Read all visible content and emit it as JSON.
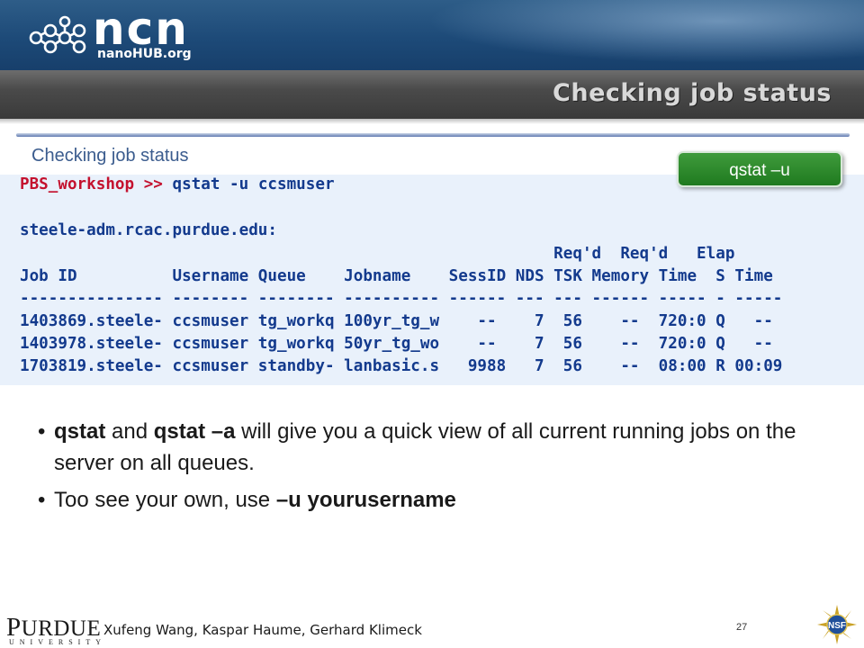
{
  "header": {
    "logo_text": "ncn",
    "logo_subtext": "nanoHUB.org",
    "slide_title": "Checking job status"
  },
  "content": {
    "sub_heading": "Checking job status",
    "badge_label": "qstat –u"
  },
  "terminal": {
    "prompt": "PBS_workshop",
    "prompt_symbol": ">>",
    "command": " qstat -u ccsmuser",
    "host_line": "steele-adm.rcac.purdue.edu:",
    "header_line_1": "                                                        Req'd  Req'd   Elap",
    "header_line_2": "Job ID          Username Queue    Jobname    SessID NDS TSK Memory Time  S Time",
    "separator": "--------------- -------- -------- ---------- ------ --- --- ------ ----- - -----",
    "rows": [
      "1403869.steele- ccsmuser tg_workq 100yr_tg_w    --    7  56    --  720:0 Q   --",
      "1403978.steele- ccsmuser tg_workq 50yr_tg_wo    --    7  56    --  720:0 Q   --",
      "1703819.steele- ccsmuser standby- lanbasic.s   9988   7  56    --  08:00 R 00:09"
    ]
  },
  "bullets": [
    {
      "part1_bold": "qstat",
      "part2": " and ",
      "part3_bold": "qstat –a",
      "part4": " will give you a quick view of all current running jobs on the server on all queues."
    },
    {
      "part1": "Too see your own, use ",
      "part2_bold": "–u yourusername"
    }
  ],
  "footer": {
    "university_initial": "P",
    "university_rest": "URDUE",
    "university_sub": "UNIVERSITY",
    "authors": "Xufeng Wang, Kaspar Haume, Gerhard Klimeck",
    "page_number": "27",
    "nsf_logo_text": "NSF"
  },
  "colors": {
    "banner_blue": "#1d4a78",
    "title_bar": "#4a4a4a",
    "terminal_bg": "#e9f1fb",
    "terminal_text": "#133a8d",
    "prompt_red": "#c4112e",
    "badge_green": "#2b8a2b",
    "subheading_blue": "#3b5c8e"
  }
}
